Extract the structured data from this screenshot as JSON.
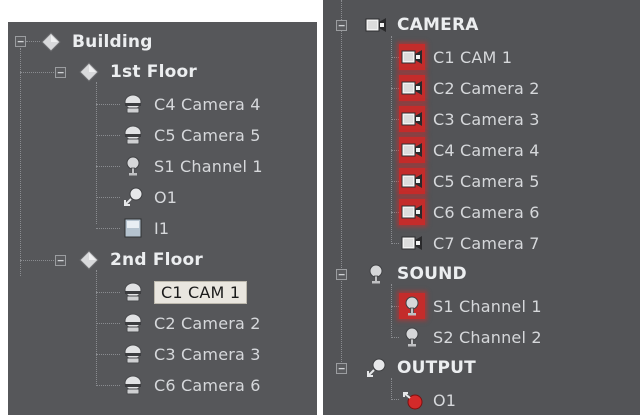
{
  "left_tree": {
    "root": {
      "label": "Building",
      "icon": "diamond-icon"
    },
    "groups": [
      {
        "label": "1st Floor",
        "icon": "diamond-icon",
        "items": [
          {
            "label": "C4 Camera 4",
            "icon": "dome-camera-icon"
          },
          {
            "label": "C5 Camera 5",
            "icon": "dome-camera-icon"
          },
          {
            "label": "S1 Channel 1",
            "icon": "microphone-icon"
          },
          {
            "label": "O1",
            "icon": "output-icon"
          },
          {
            "label": "I1",
            "icon": "input-icon"
          }
        ]
      },
      {
        "label": "2nd Floor",
        "icon": "diamond-icon",
        "items": [
          {
            "label": "C1 CAM 1",
            "icon": "dome-camera-icon",
            "selected": true
          },
          {
            "label": "C2 Camera 2",
            "icon": "dome-camera-icon"
          },
          {
            "label": "C3 Camera 3",
            "icon": "dome-camera-icon"
          },
          {
            "label": "C6 Camera 6",
            "icon": "dome-camera-icon"
          }
        ]
      }
    ]
  },
  "right_tree": {
    "groups": [
      {
        "label": "CAMERA",
        "icon": "camera-icon",
        "items": [
          {
            "label": "C1 CAM 1",
            "icon": "camera-icon",
            "alert": true
          },
          {
            "label": "C2 Camera 2",
            "icon": "camera-icon",
            "alert": true
          },
          {
            "label": "C3 Camera 3",
            "icon": "camera-icon",
            "alert": true
          },
          {
            "label": "C4 Camera 4",
            "icon": "camera-icon",
            "alert": true
          },
          {
            "label": "C5 Camera 5",
            "icon": "camera-icon",
            "alert": true
          },
          {
            "label": "C6 Camera 6",
            "icon": "camera-icon",
            "alert": true
          },
          {
            "label": "C7 Camera 7",
            "icon": "camera-icon",
            "alert": false
          }
        ]
      },
      {
        "label": "SOUND",
        "icon": "microphone-icon",
        "items": [
          {
            "label": "S1 Channel 1",
            "icon": "microphone-icon",
            "alert": true
          },
          {
            "label": "S2 Channel 2",
            "icon": "microphone-icon",
            "alert": false
          }
        ]
      },
      {
        "label": "OUTPUT",
        "icon": "output-icon",
        "items": [
          {
            "label": "O1",
            "icon": "output-active-icon",
            "alert": false
          }
        ]
      }
    ]
  },
  "colors": {
    "panel_bg": "#56575a",
    "alert_red": "#c42c2b",
    "text": "#d6d8db"
  }
}
